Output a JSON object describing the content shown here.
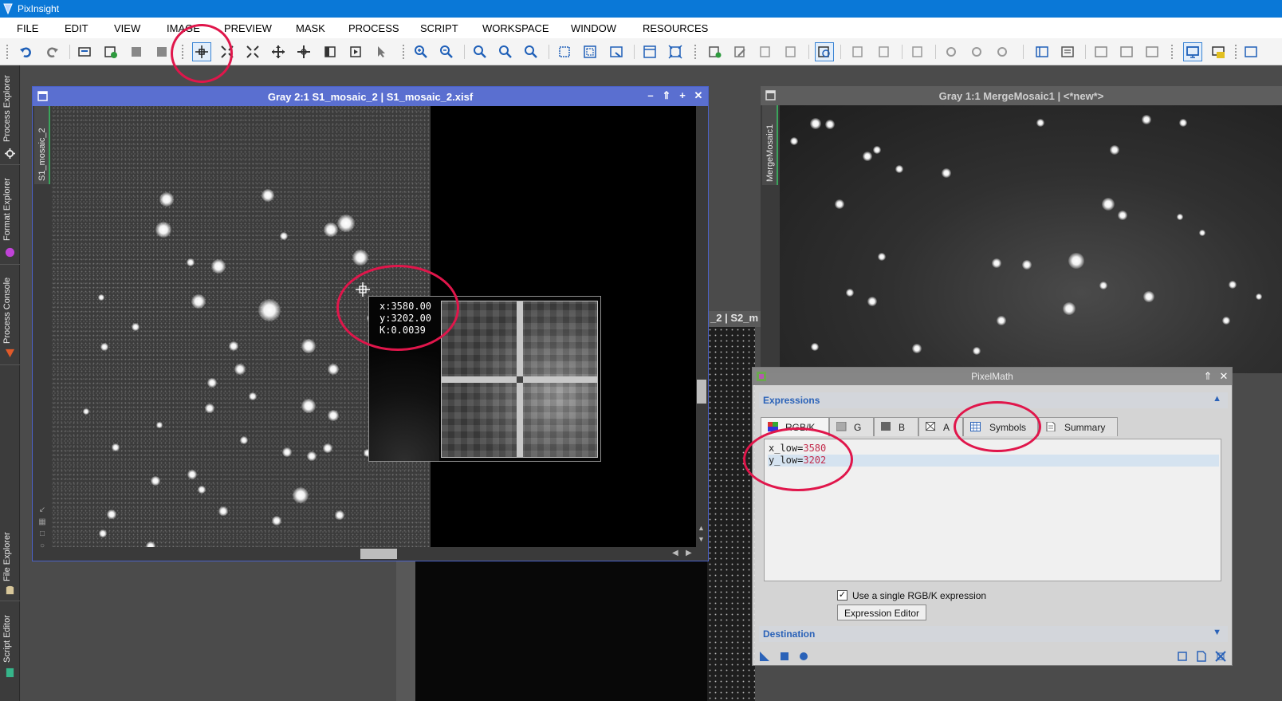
{
  "app": {
    "title": "PixInsight"
  },
  "menu": [
    "FILE",
    "EDIT",
    "VIEW",
    "IMAGE",
    "PREVIEW",
    "MASK",
    "PROCESS",
    "SCRIPT",
    "WORKSPACE",
    "WINDOW",
    "RESOURCES"
  ],
  "sidebar": {
    "tabs": [
      "Process Explorer",
      "Format Explorer",
      "Process Console",
      "File Explorer",
      "Script Editor"
    ]
  },
  "image_window_1": {
    "title": "Gray 2:1 S1_mosaic_2 | S1_mosaic_2.xisf",
    "tab_label": "S1_mosaic_2",
    "readout": {
      "x": "x:3580.00",
      "y": "y:3202.00",
      "k": "K:0.0039"
    }
  },
  "image_window_2": {
    "title": "Gray 1:1 MergeMosaic1 | <*new*>",
    "tab_label": "MergeMosaic1"
  },
  "background_window": {
    "title_fragment": "_2 | S2_m"
  },
  "pixelmath": {
    "title": "PixelMath",
    "expressions_section": "Expressions",
    "tabs": [
      "RGB/K",
      "G",
      "B",
      "A",
      "Symbols",
      "Summary"
    ],
    "editor_lines": [
      {
        "name": "x_low",
        "value": "3580"
      },
      {
        "name": "y_low",
        "value": "3202"
      }
    ],
    "single_expression_label": "Use a single RGB/K expression",
    "single_expression_checked": true,
    "expression_editor_button": "Expression Editor",
    "destination_section": "Destination"
  },
  "colors": {
    "titlebar": "#0a78d7",
    "active_window_title": "#5a6fd0",
    "annotation": "#e0164b",
    "section_text": "#2a62b8",
    "number_text": "#c22a4a"
  }
}
